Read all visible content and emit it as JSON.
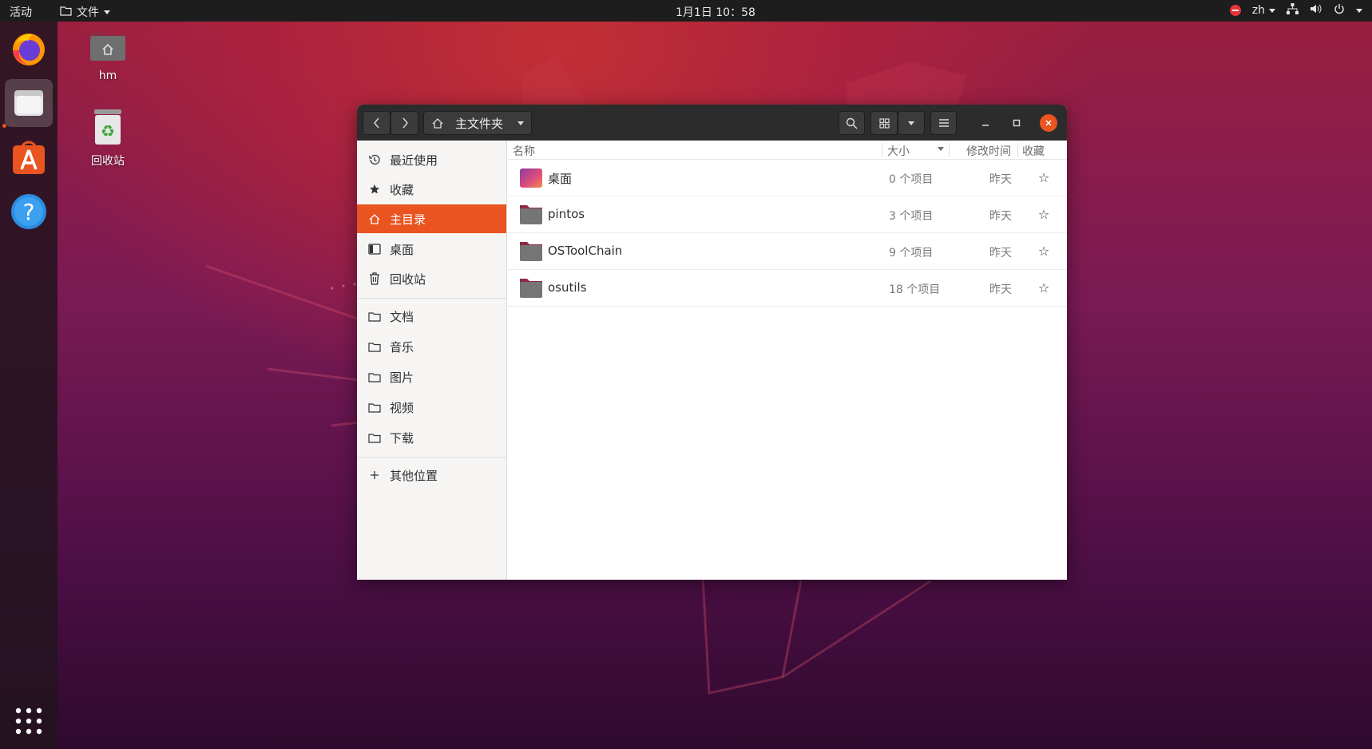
{
  "topbar": {
    "activities": "活动",
    "app_menu": "文件",
    "clock": "1月1日  10：58",
    "lang": "zh"
  },
  "desktop": {
    "icons": [
      {
        "label": "hm",
        "icon": "home-folder-icon"
      },
      {
        "label": "回收站",
        "icon": "trash-icon"
      }
    ]
  },
  "dock": {
    "items": [
      "firefox-icon",
      "files-icon",
      "software-center-icon",
      "help-icon",
      "app-grid-icon"
    ]
  },
  "window": {
    "path": "主文件夹",
    "sidebar": {
      "items": [
        {
          "label": "最近使用",
          "icon": "clock-icon"
        },
        {
          "label": "收藏",
          "icon": "star-icon"
        },
        {
          "label": "主目录",
          "icon": "home-icon",
          "selected": true
        },
        {
          "label": "桌面",
          "icon": "desktop-icon"
        },
        {
          "label": "回收站",
          "icon": "trash-icon"
        },
        {
          "label": "文档",
          "icon": "folder-icon"
        },
        {
          "label": "音乐",
          "icon": "folder-icon"
        },
        {
          "label": "图片",
          "icon": "folder-icon"
        },
        {
          "label": "视频",
          "icon": "folder-icon"
        },
        {
          "label": "下载",
          "icon": "folder-icon"
        },
        {
          "label": "其他位置",
          "icon": "plus-icon"
        }
      ]
    },
    "columns": {
      "name": "名称",
      "size": "大小",
      "modified": "修改时间",
      "starred": "收藏"
    },
    "rows": [
      {
        "name": "桌面",
        "size": "0 个项目",
        "modified": "昨天",
        "icon": "desktop-folder-icon"
      },
      {
        "name": "pintos",
        "size": "3 个项目",
        "modified": "昨天",
        "icon": "folder-icon"
      },
      {
        "name": "OSToolChain",
        "size": "9 个项目",
        "modified": "昨天",
        "icon": "folder-icon"
      },
      {
        "name": "osutils",
        "size": "18 个项目",
        "modified": "昨天",
        "icon": "folder-icon"
      }
    ]
  },
  "colors": {
    "accent": "#e95420",
    "headerbar": "#2c2c2c",
    "topbar": "#1d1d1d"
  }
}
